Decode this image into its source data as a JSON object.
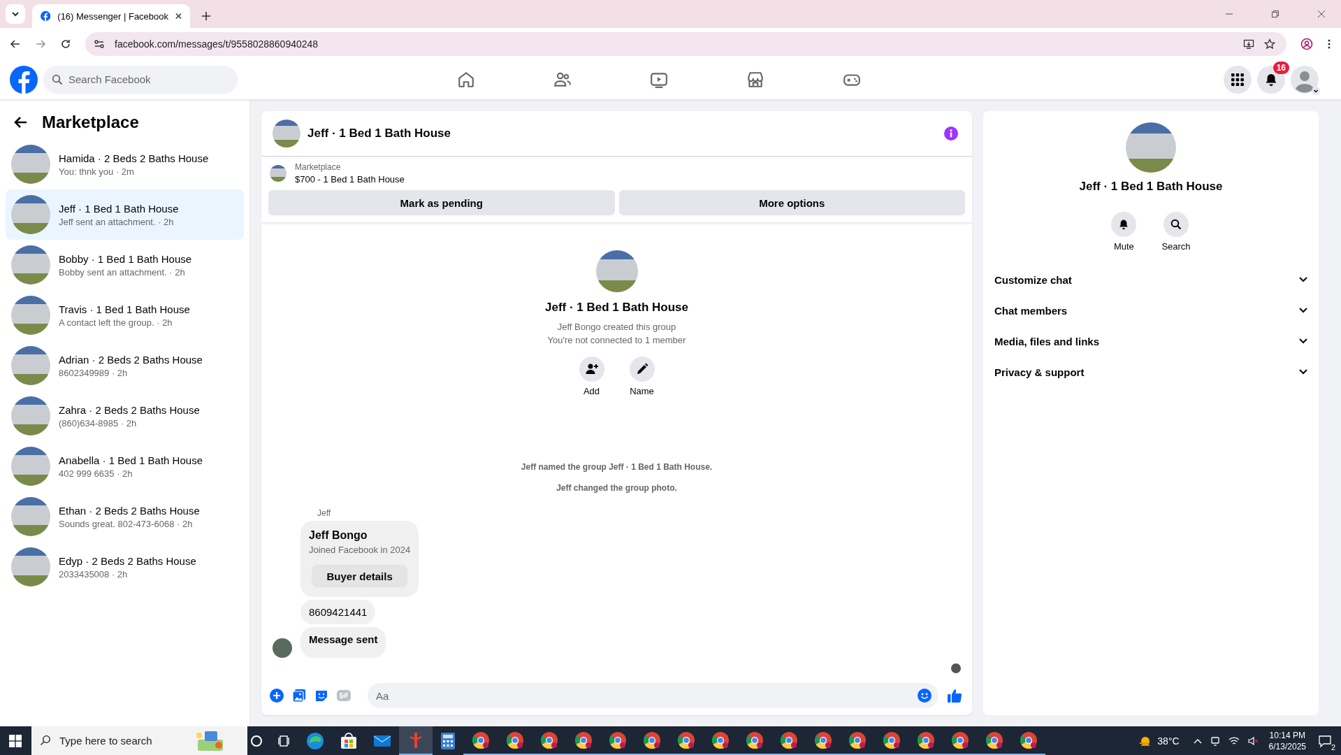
{
  "browser": {
    "tab_title": "(16) Messenger | Facebook",
    "url": "facebook.com/messages/t/9558028860940248"
  },
  "topbar": {
    "search_placeholder": "Search Facebook",
    "notification_count": "16"
  },
  "sidebar": {
    "title": "Marketplace",
    "conversations": [
      {
        "name": "Hamida · 2 Beds 2 Baths House",
        "preview": "You: thnk you · 2m",
        "selected": false
      },
      {
        "name": "Jeff · 1 Bed 1 Bath House",
        "preview": "Jeff sent an attachment. · 2h",
        "selected": true
      },
      {
        "name": "Bobby · 1 Bed 1 Bath House",
        "preview": "Bobby sent an attachment. · 2h",
        "selected": false
      },
      {
        "name": "Travis · 1 Bed 1 Bath House",
        "preview": "A contact left the group. · 2h",
        "selected": false
      },
      {
        "name": "Adrian · 2 Beds 2 Baths House",
        "preview": "8602349989 · 2h",
        "selected": false
      },
      {
        "name": "Zahra · 2 Beds 2 Baths House",
        "preview": "(860)634-8985 · 2h",
        "selected": false
      },
      {
        "name": "Anabella · 1 Bed 1 Bath House",
        "preview": "402 999 6635 · 2h",
        "selected": false
      },
      {
        "name": "Ethan · 2 Beds 2 Baths House",
        "preview": "Sounds great. 802-473-6068 · 2h",
        "selected": false
      },
      {
        "name": "Edyp · 2 Beds 2 Baths House",
        "preview": "2033435008 · 2h",
        "selected": false
      }
    ]
  },
  "chat": {
    "title": "Jeff · 1 Bed 1 Bath House",
    "listing": {
      "label": "Marketplace",
      "title": "$700 - 1 Bed 1 Bath House"
    },
    "actions": [
      "Mark as pending",
      "More options"
    ],
    "intro": {
      "title": "Jeff · 1 Bed 1 Bath House",
      "lines": [
        "Jeff Bongo created this group",
        "You're not connected to 1 member"
      ],
      "buttons": [
        {
          "kind": "add",
          "label": "Add"
        },
        {
          "kind": "name",
          "label": "Name"
        }
      ]
    },
    "events": [
      "Jeff named the group Jeff · 1 Bed 1 Bath House.",
      "Jeff changed the group photo."
    ],
    "sender": "Jeff",
    "messages": [
      {
        "kind": "card",
        "title": "Jeff Bongo",
        "subtitle": "Joined Facebook in 2024",
        "button": "Buyer details"
      },
      {
        "kind": "text",
        "text": "8609421441"
      },
      {
        "kind": "status",
        "text": "Message sent"
      }
    ],
    "composer_placeholder": "Aa"
  },
  "details": {
    "title": "Jeff · 1 Bed 1 Bath House",
    "buttons": [
      {
        "kind": "mute",
        "label": "Mute"
      },
      {
        "kind": "search",
        "label": "Search"
      }
    ],
    "sections": [
      {
        "label": "Customize chat",
        "expanded": false
      },
      {
        "label": "Chat members",
        "expanded": false
      },
      {
        "label": "Media, files and links",
        "expanded": false
      },
      {
        "label": "Privacy & support",
        "expanded": false
      }
    ]
  },
  "taskbar": {
    "search_placeholder": "Type here to search",
    "weather": "38°C",
    "time": "10:14 PM",
    "date": "6/13/2025",
    "notifications": "2"
  }
}
